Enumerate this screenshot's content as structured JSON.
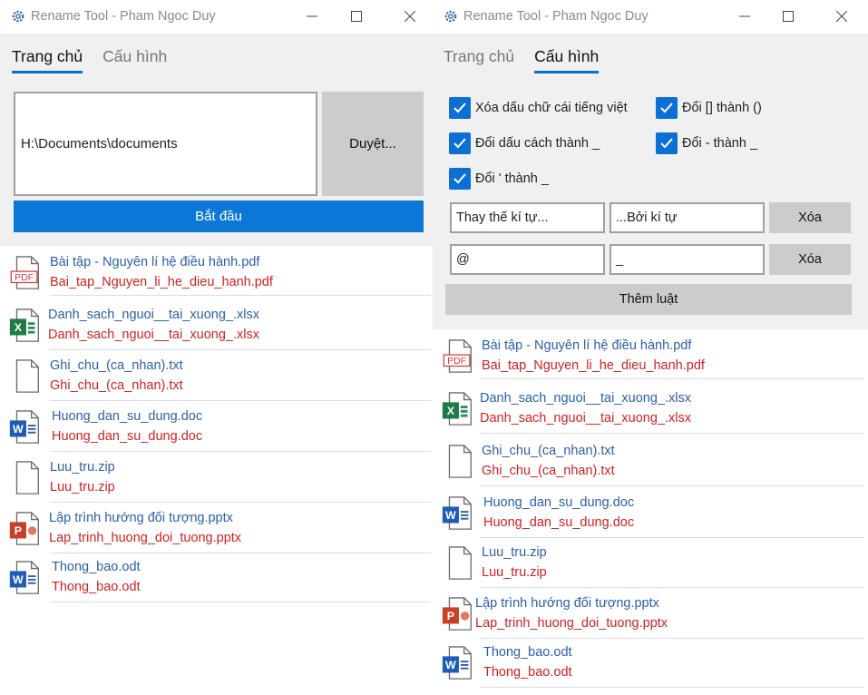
{
  "left_window": {
    "title": "Rename Tool - Pham Ngoc Duy",
    "tabs": [
      {
        "label": "Trang chủ",
        "active": true
      },
      {
        "label": "Cấu hình",
        "active": false
      }
    ],
    "path_value": "H:\\Documents\\documents",
    "browse_label": "Duyệt...",
    "start_label": "Bắt đầu",
    "files": [
      {
        "name": "Bài tập - Nguyên lí hệ điều hành.pdf",
        "new_name": "Bai_tap_Nguyen_li_he_dieu_hanh.pdf",
        "icon": "pdf-file-icon"
      },
      {
        "name": "Danh_sach_nguoi__tai_xuong_.xlsx",
        "new_name": "Danh_sach_nguoi__tai_xuong_.xlsx",
        "icon": "excel-file-icon"
      },
      {
        "name": "Ghi_chu_(ca_nhan).txt",
        "new_name": "Ghi_chu_(ca_nhan).txt",
        "icon": "text-file-icon"
      },
      {
        "name": "Huong_dan_su_dung.doc",
        "new_name": "Huong_dan_su_dung.doc",
        "icon": "word-file-icon"
      },
      {
        "name": "Luu_tru.zip",
        "new_name": "Luu_tru.zip",
        "icon": "zip-file-icon"
      },
      {
        "name": "Lập trình hướng đối tượng.pptx",
        "new_name": "Lap_trinh_huong_doi_tuong.pptx",
        "icon": "powerpoint-file-icon"
      },
      {
        "name": "Thong_bao.odt",
        "new_name": "Thong_bao.odt",
        "icon": "word-file-icon"
      }
    ]
  },
  "right_window": {
    "title": "Rename Tool - Pham Ngoc Duy",
    "tabs": [
      {
        "label": "Trang chủ",
        "active": false
      },
      {
        "label": "Cấu hình",
        "active": true
      }
    ],
    "options": [
      {
        "label": "Xóa dấu chữ cái tiếng việt",
        "checked": true
      },
      {
        "label": "Đổi [] thành ()",
        "checked": true
      },
      {
        "label": "Đổi dấu cách thành _",
        "checked": true
      },
      {
        "label": "Đổi - thành _",
        "checked": true
      },
      {
        "label": "Đổi ' thành _",
        "checked": true
      }
    ],
    "rules": [
      {
        "find": "Thay thế kí tự...",
        "replace": "...Bởi kí tự",
        "delete_label": "Xóa"
      },
      {
        "find": "@",
        "replace": "_",
        "delete_label": "Xóa"
      }
    ],
    "add_rule_label": "Thêm luật",
    "files": [
      {
        "name": "Bài tập - Nguyên lí hệ điều hành.pdf",
        "new_name": "Bai_tap_Nguyen_li_he_dieu_hanh.pdf",
        "icon": "pdf-file-icon"
      },
      {
        "name": "Danh_sach_nguoi__tai_xuong_.xlsx",
        "new_name": "Danh_sach_nguoi__tai_xuong_.xlsx",
        "icon": "excel-file-icon"
      },
      {
        "name": "Ghi_chu_(ca_nhan).txt",
        "new_name": "Ghi_chu_(ca_nhan).txt",
        "icon": "text-file-icon"
      },
      {
        "name": "Huong_dan_su_dung.doc",
        "new_name": "Huong_dan_su_dung.doc",
        "icon": "word-file-icon"
      },
      {
        "name": "Luu_tru.zip",
        "new_name": "Luu_tru.zip",
        "icon": "zip-file-icon"
      },
      {
        "name": "Lập trình hướng đối tượng.pptx",
        "new_name": "Lap_trinh_huong_doi_tuong.pptx",
        "icon": "powerpoint-file-icon"
      },
      {
        "name": "Thong_bao.odt",
        "new_name": "Thong_bao.odt",
        "icon": "word-file-icon"
      }
    ]
  },
  "colors": {
    "accent": "#0b6fd4",
    "start_button": "#0b78d7",
    "original_name": "#2a5faa",
    "new_name": "#d21f1f",
    "panel_bg": "#f0f0f0",
    "button_gray": "#cccccc"
  }
}
